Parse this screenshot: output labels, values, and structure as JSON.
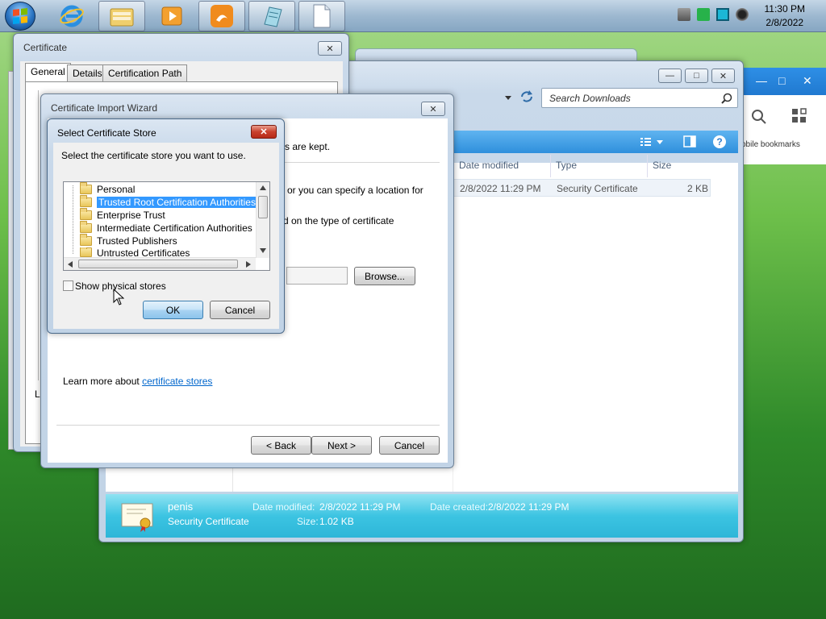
{
  "taskbar": {
    "time": "11:30 PM",
    "date": "2/8/2022",
    "pinned": [
      "internet-explorer",
      "windows-explorer",
      "media-player",
      "uc-browser",
      "notepad",
      "document"
    ]
  },
  "browser": {
    "bookmarks_label": "obile bookmarks"
  },
  "explorer": {
    "search_placeholder": "Search Downloads",
    "columns": [
      "Date modified",
      "Type",
      "Size"
    ],
    "file_row": {
      "date_modified": "2/8/2022 11:29 PM",
      "type": "Security Certificate",
      "size": "2 KB"
    },
    "details": {
      "name": "penis",
      "type": "Security Certificate",
      "date_modified_label": "Date modified:",
      "date_modified": "2/8/2022 11:29 PM",
      "date_created_label": "Date created:",
      "date_created": "2/8/2022 11:29 PM",
      "size_label": "Size:",
      "size": "1.02 KB"
    }
  },
  "certificate": {
    "title": "Certificate",
    "tabs": [
      "General",
      "Details",
      "Certification Path"
    ],
    "partial_text": "Le"
  },
  "wizard": {
    "title": "Certificate Import Wizard",
    "text_kept": "s are kept.",
    "text_location": "or you can specify a location for",
    "text_based": "d on the type of certificate",
    "browse_label": "Browse...",
    "learn_more_prefix": "Learn more about ",
    "learn_more_link": "certificate stores",
    "back_label": "< Back",
    "next_label": "Next >",
    "cancel_label": "Cancel"
  },
  "store_dialog": {
    "title": "Select Certificate Store",
    "instruction": "Select the certificate store you want to use.",
    "stores": [
      "Personal",
      "Trusted Root Certification Authorities",
      "Enterprise Trust",
      "Intermediate Certification Authorities",
      "Trusted Publishers",
      "Untrusted Certificates"
    ],
    "selected_index": 1,
    "show_physical_label": "Show physical stores",
    "ok_label": "OK",
    "cancel_label": "Cancel"
  }
}
